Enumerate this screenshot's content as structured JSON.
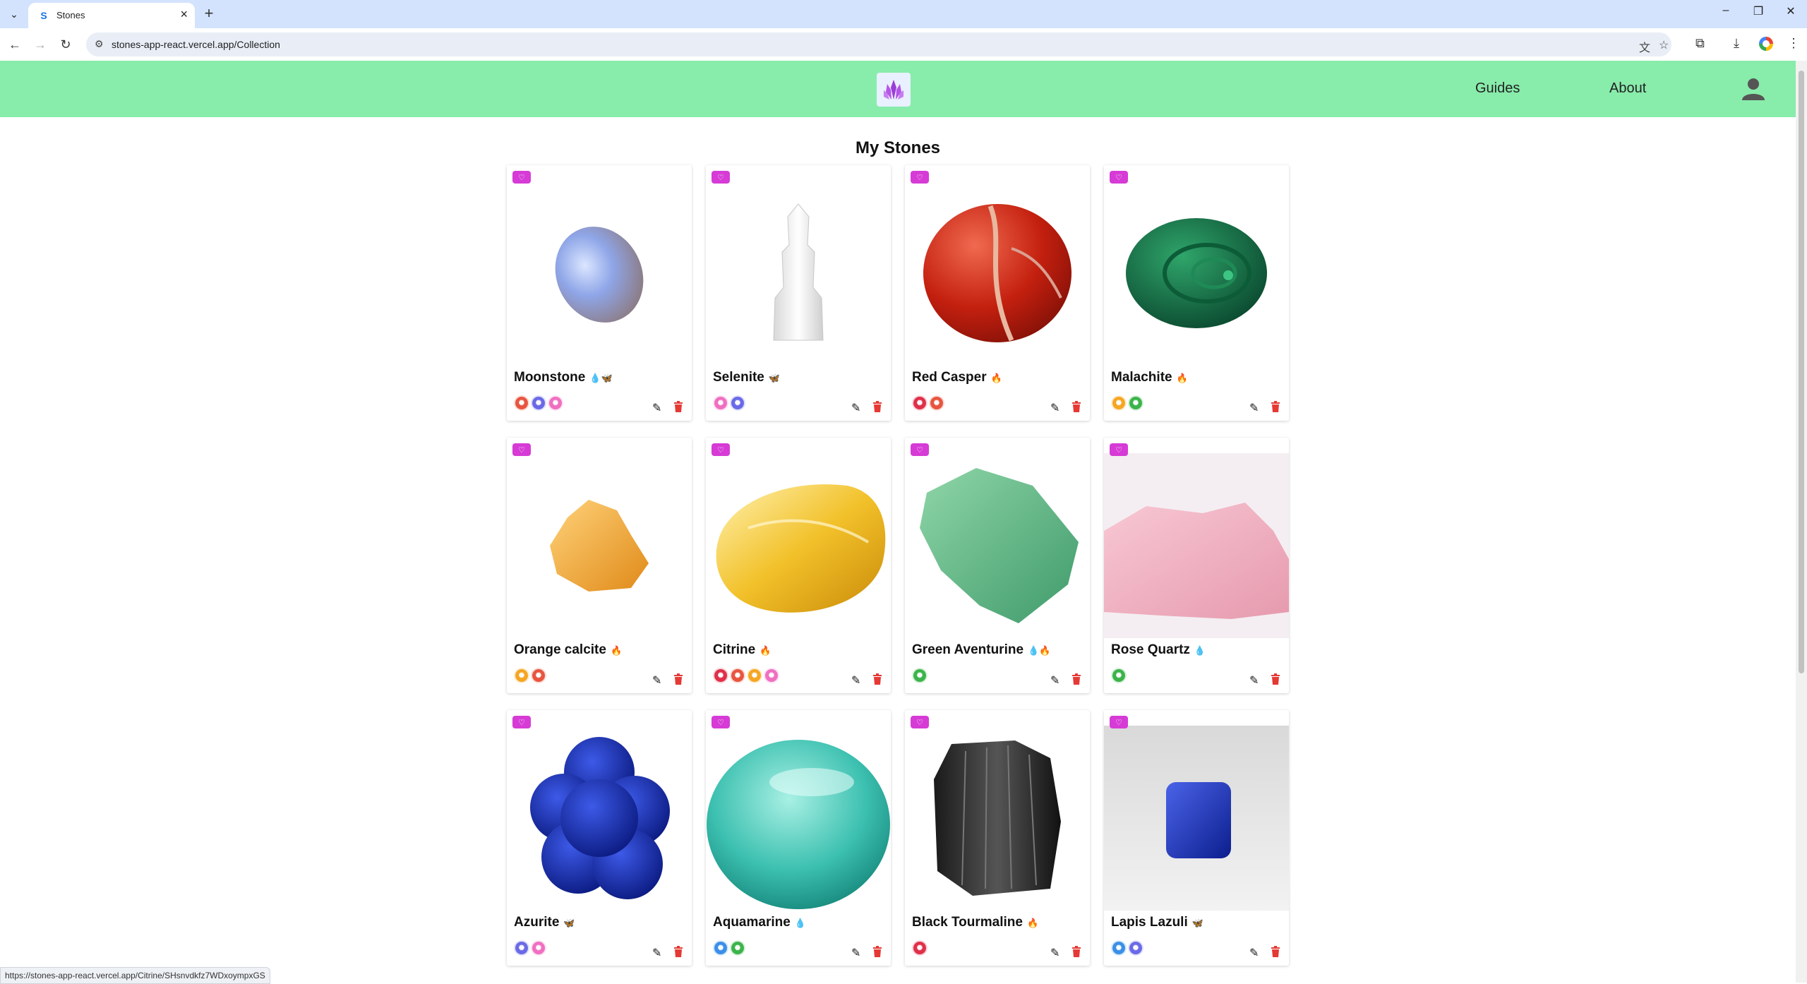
{
  "browser": {
    "tab_title": "Stones",
    "url": "stones-app-react.vercel.app/Collection",
    "status_url": "https://stones-app-react.vercel.app/Citrine/SHsnvdkfz7WDxoympxGS"
  },
  "header": {
    "nav": [
      {
        "label": "Guides"
      },
      {
        "label": "About"
      }
    ]
  },
  "page_title": "My Stones",
  "colors": {
    "header_bg": "#88ecab",
    "favorite": "#d63bd6",
    "delete": "#e53935"
  },
  "stones": [
    {
      "name": "Moonstone",
      "icons": "💧🦋",
      "chakras": [
        "#e8553f",
        "#6a6ae8",
        "#f06fc0"
      ],
      "image": "moonstone"
    },
    {
      "name": "Selenite",
      "icons": "🦋",
      "chakras": [
        "#f06fc0",
        "#6a6ae8"
      ],
      "image": "selenite"
    },
    {
      "name": "Red Casper",
      "icons": "🔥",
      "chakras": [
        "#e0304a",
        "#e8553f"
      ],
      "image": "red-jasper"
    },
    {
      "name": "Malachite",
      "icons": "🔥",
      "chakras": [
        "#f5a623",
        "#3cb44b"
      ],
      "image": "malachite"
    },
    {
      "name": "Orange calcite",
      "icons": "🔥",
      "chakras": [
        "#f5a623",
        "#e8553f"
      ],
      "image": "orange-calcite"
    },
    {
      "name": "Citrine",
      "icons": "🔥",
      "chakras": [
        "#e0304a",
        "#e8553f",
        "#f5a623",
        "#f06fc0"
      ],
      "image": "citrine"
    },
    {
      "name": "Green Aventurine",
      "icons": "💧🔥",
      "chakras": [
        "#3cb44b"
      ],
      "image": "green-aventurine"
    },
    {
      "name": "Rose Quartz",
      "icons": "💧",
      "chakras": [
        "#3cb44b"
      ],
      "image": "rose-quartz"
    },
    {
      "name": "Azurite",
      "icons": "🦋",
      "chakras": [
        "#6a6ae8",
        "#f06fc0"
      ],
      "image": "azurite"
    },
    {
      "name": "Aquamarine",
      "icons": "💧",
      "chakras": [
        "#3b8fe8",
        "#3cb44b"
      ],
      "image": "aquamarine"
    },
    {
      "name": "Black Tourmaline",
      "icons": "🔥",
      "chakras": [
        "#e0304a"
      ],
      "image": "black-tourmaline"
    },
    {
      "name": "Lapis Lazuli",
      "icons": "🦋",
      "chakras": [
        "#3b8fe8",
        "#6a6ae8"
      ],
      "image": "lapis-lazuli"
    }
  ]
}
